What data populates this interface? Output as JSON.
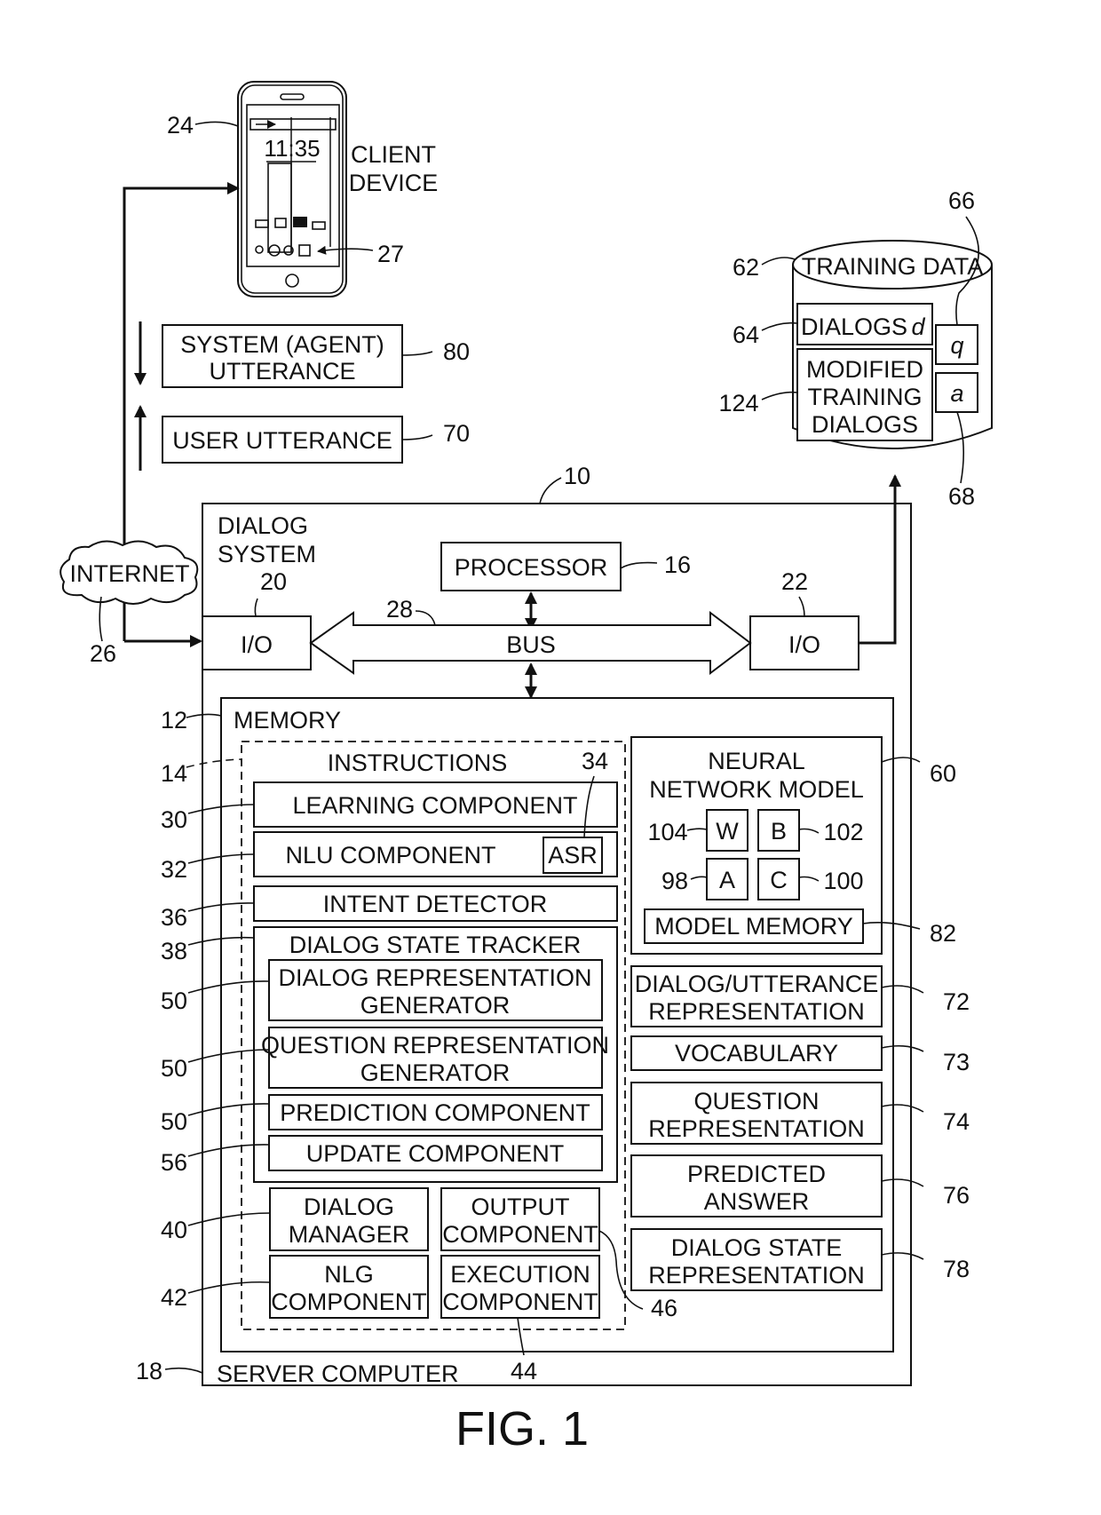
{
  "figure": {
    "caption": "FIG. 1",
    "client_device": {
      "line1": "CLIENT",
      "line2": "DEVICE",
      "clock": "11:35",
      "ref": "24",
      "screen_ref": "27"
    },
    "system_utterance": {
      "line1": "SYSTEM (AGENT)",
      "line2": "UTTERANCE",
      "ref": "80"
    },
    "user_utterance": {
      "label": "USER UTTERANCE",
      "ref": "70"
    },
    "internet": {
      "label": "INTERNET",
      "ref": "26"
    },
    "training_data": {
      "label": "TRAINING DATA",
      "ref": "62",
      "dialogs": {
        "label": "DIALOGS ",
        "var": "d",
        "ref": "64"
      },
      "modified": {
        "line1": "MODIFIED",
        "line2": "TRAINING",
        "line3": "DIALOGS",
        "ref": "124"
      },
      "q": {
        "label": "q",
        "ref": "66"
      },
      "a": {
        "label": "a",
        "ref": "68"
      }
    },
    "dialog_system": {
      "line1": "DIALOG",
      "line2": "SYSTEM",
      "ref": "10"
    },
    "processor": {
      "label": "PROCESSOR",
      "ref": "16"
    },
    "io_left": {
      "label": "I/O",
      "ref": "20"
    },
    "io_right": {
      "label": "I/O",
      "ref": "22"
    },
    "bus": {
      "label": "BUS",
      "ref": "28"
    },
    "memory": {
      "label": "MEMORY",
      "ref": "12"
    },
    "instructions": {
      "label": "INSTRUCTIONS",
      "ref": "14"
    },
    "learning": {
      "label": "LEARNING COMPONENT",
      "ref": "30"
    },
    "nlu": {
      "label": "NLU COMPONENT",
      "ref": "32"
    },
    "asr": {
      "label": "ASR",
      "ref": "34"
    },
    "intent": {
      "label": "INTENT DETECTOR",
      "ref": "36"
    },
    "dst": {
      "label": "DIALOG STATE TRACKER",
      "ref": "38"
    },
    "dialog_rep_gen": {
      "line1": "DIALOG REPRESENTATION",
      "line2": "GENERATOR",
      "ref": "50"
    },
    "question_rep_gen": {
      "line1": "QUESTION REPRESENTATION",
      "line2": "GENERATOR",
      "ref": "50"
    },
    "prediction": {
      "label": "PREDICTION COMPONENT",
      "ref": "50"
    },
    "update": {
      "label": "UPDATE COMPONENT",
      "ref": "56"
    },
    "dialog_manager": {
      "line1": "DIALOG",
      "line2": "MANAGER",
      "ref": "40"
    },
    "output_comp": {
      "line1": "OUTPUT",
      "line2": "COMPONENT",
      "ref": "46"
    },
    "nlg": {
      "line1": "NLG",
      "line2": "COMPONENT",
      "ref": "42"
    },
    "execution": {
      "line1": "EXECUTION",
      "line2": "COMPONENT",
      "ref": "44"
    },
    "server": {
      "label": "SERVER COMPUTER",
      "ref": "18"
    },
    "nn_model": {
      "line1": "NEURAL",
      "line2": "NETWORK MODEL",
      "ref": "60"
    },
    "param_w": {
      "label": "W",
      "ref": "104"
    },
    "param_b": {
      "label": "B",
      "ref": "102"
    },
    "param_a": {
      "label": "A",
      "ref": "98"
    },
    "param_c": {
      "label": "C",
      "ref": "100"
    },
    "model_memory": {
      "label": "MODEL MEMORY",
      "ref": "82"
    },
    "dialog_utt_rep": {
      "line1": "DIALOG/UTTERANCE",
      "line2": "REPRESENTATION",
      "ref": "72"
    },
    "vocabulary": {
      "label": "VOCABULARY",
      "ref": "73"
    },
    "question_rep": {
      "line1": "QUESTION",
      "line2": "REPRESENTATION",
      "ref": "74"
    },
    "predicted_answer": {
      "line1": "PREDICTED",
      "line2": "ANSWER",
      "ref": "76"
    },
    "dialog_state_rep": {
      "line1": "DIALOG STATE",
      "line2": "REPRESENTATION",
      "ref": "78"
    }
  }
}
